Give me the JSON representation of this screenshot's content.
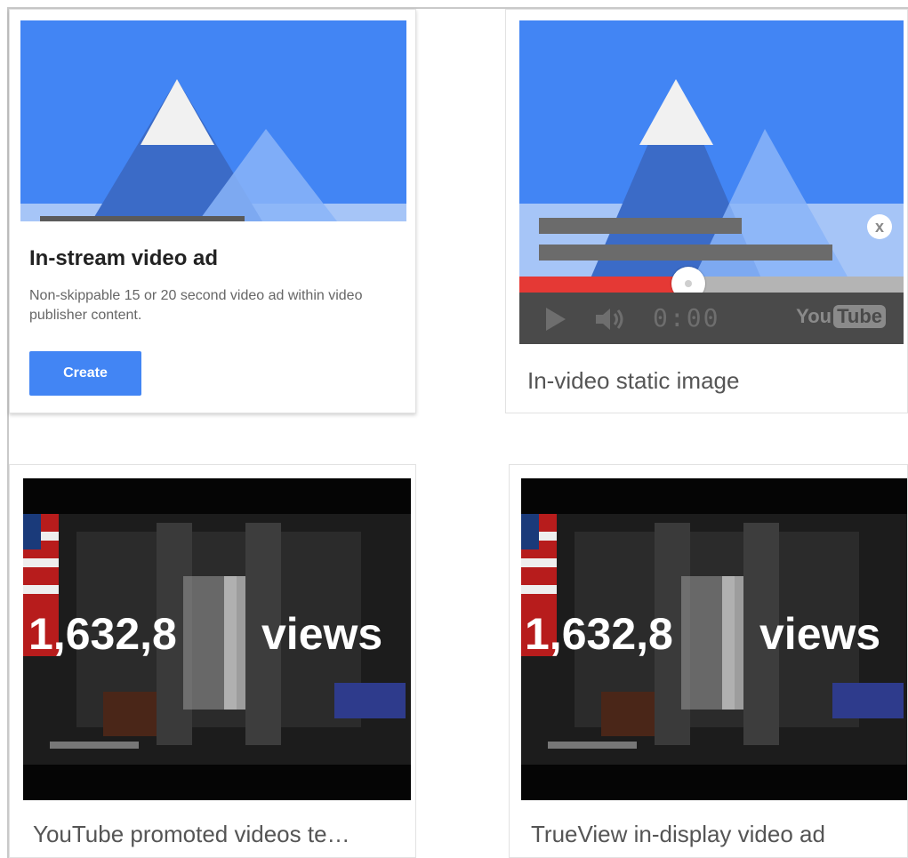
{
  "cards": [
    {
      "title": "In-stream video ad",
      "description": "Non-skippable 15 or 20 second video ad within video publisher content.",
      "button_label": "Create"
    },
    {
      "caption": "In-video static image",
      "close_glyph": "x",
      "player": {
        "time": "0:00",
        "progress_fraction": 0.44,
        "logo_you": "You",
        "logo_tube": "Tube"
      }
    },
    {
      "caption": "YouTube promoted videos te…",
      "counter": "1,632,8",
      "counter_suffix": "views"
    },
    {
      "caption": "TrueView in-display video ad",
      "counter": "1,632,8",
      "counter_suffix": "views"
    }
  ],
  "colors": {
    "sky_blue": "#4285f4",
    "light_blue": "#8ab4f8",
    "dark_mountain": "#3b6bc7",
    "snow": "#f1f1f1",
    "progress_red": "#e53935",
    "button_blue": "#4285f4"
  },
  "icons": [
    "mountain-illustration",
    "close-icon",
    "play-icon",
    "volume-icon",
    "youtube-logo"
  ]
}
